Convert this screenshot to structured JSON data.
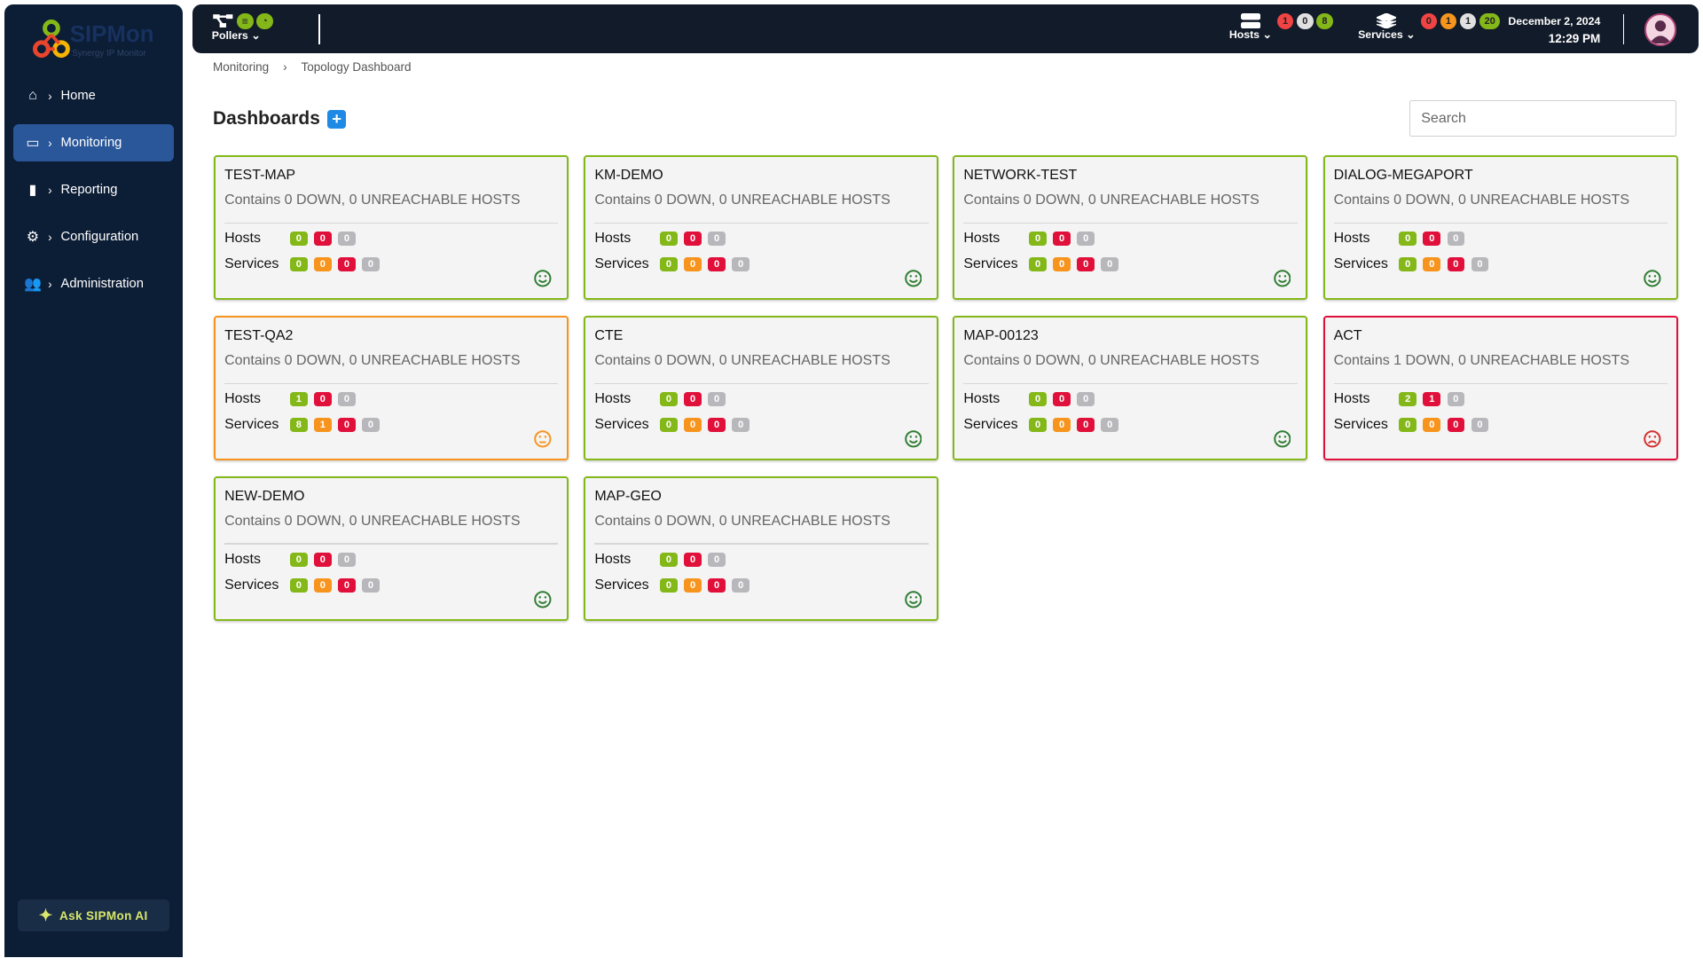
{
  "brand": {
    "name": "SIPMon",
    "tagline": "Synergy IP Monitor"
  },
  "sidebar": {
    "items": [
      {
        "label": "Home",
        "icon": "home-icon",
        "active": false
      },
      {
        "label": "Monitoring",
        "icon": "monitor-icon",
        "active": true
      },
      {
        "label": "Reporting",
        "icon": "bar-chart-icon",
        "active": false
      },
      {
        "label": "Configuration",
        "icon": "gear-icon",
        "active": false
      },
      {
        "label": "Administration",
        "icon": "users-icon",
        "active": false
      }
    ],
    "ask_label": "Ask SIPMon AI"
  },
  "topbar": {
    "pollers_label": "Pollers",
    "hosts": {
      "label": "Hosts",
      "counts": [
        "1",
        "0",
        "8"
      ]
    },
    "services": {
      "label": "Services",
      "counts": [
        "0",
        "1",
        "1",
        "20"
      ]
    },
    "date": "December 2, 2024",
    "time": "12:29 PM"
  },
  "breadcrumb": [
    "Monitoring",
    "Topology Dashboard"
  ],
  "page": {
    "title": "Dashboards",
    "search_placeholder": "Search"
  },
  "colors": {
    "ok": "#84b819",
    "warning": "#f7941d",
    "critical": "#e0103a",
    "unknown": "#b8b8bc",
    "gray_circle": "#e0e0e0",
    "red_circle": "#f04444"
  },
  "dashboards": [
    {
      "name": "TEST-MAP",
      "desc": "Contains 0 DOWN, 0 UNREACHABLE HOSTS",
      "status": "ok",
      "hosts": [
        "0",
        "0",
        "0"
      ],
      "services": [
        "0",
        "0",
        "0",
        "0"
      ]
    },
    {
      "name": "KM-DEMO",
      "desc": "Contains 0 DOWN, 0 UNREACHABLE HOSTS",
      "status": "ok",
      "hosts": [
        "0",
        "0",
        "0"
      ],
      "services": [
        "0",
        "0",
        "0",
        "0"
      ]
    },
    {
      "name": "NETWORK-TEST",
      "desc": "Contains 0 DOWN, 0 UNREACHABLE HOSTS",
      "status": "ok",
      "hosts": [
        "0",
        "0",
        "0"
      ],
      "services": [
        "0",
        "0",
        "0",
        "0"
      ]
    },
    {
      "name": "DIALOG-MEGAPORT",
      "desc": "Contains 0 DOWN, 0 UNREACHABLE HOSTS",
      "status": "ok",
      "hosts": [
        "0",
        "0",
        "0"
      ],
      "services": [
        "0",
        "0",
        "0",
        "0"
      ]
    },
    {
      "name": "TEST-QA2",
      "desc": "Contains 0 DOWN, 0 UNREACHABLE HOSTS",
      "status": "warning",
      "hosts": [
        "1",
        "0",
        "0"
      ],
      "services": [
        "8",
        "1",
        "0",
        "0"
      ]
    },
    {
      "name": "CTE",
      "desc": "Contains 0 DOWN, 0 UNREACHABLE HOSTS",
      "status": "ok",
      "hosts": [
        "0",
        "0",
        "0"
      ],
      "services": [
        "0",
        "0",
        "0",
        "0"
      ]
    },
    {
      "name": "MAP-00123",
      "desc": "Contains 0 DOWN, 0 UNREACHABLE HOSTS",
      "status": "ok",
      "hosts": [
        "0",
        "0",
        "0"
      ],
      "services": [
        "0",
        "0",
        "0",
        "0"
      ]
    },
    {
      "name": "ACT",
      "desc": "Contains 1 DOWN, 0 UNREACHABLE HOSTS",
      "status": "critical",
      "hosts": [
        "2",
        "1",
        "0"
      ],
      "services": [
        "0",
        "0",
        "0",
        "0"
      ]
    },
    {
      "name": "NEW-DEMO",
      "desc": "Contains 0 DOWN, 0 UNREACHABLE HOSTS",
      "status": "ok",
      "hosts": [
        "0",
        "0",
        "0"
      ],
      "services": [
        "0",
        "0",
        "0",
        "0"
      ]
    },
    {
      "name": "MAP-GEO",
      "desc": "Contains 0 DOWN, 0 UNREACHABLE HOSTS",
      "status": "ok",
      "hosts": [
        "0",
        "0",
        "0"
      ],
      "services": [
        "0",
        "0",
        "0",
        "0"
      ]
    }
  ],
  "labels": {
    "hosts": "Hosts",
    "services": "Services"
  }
}
